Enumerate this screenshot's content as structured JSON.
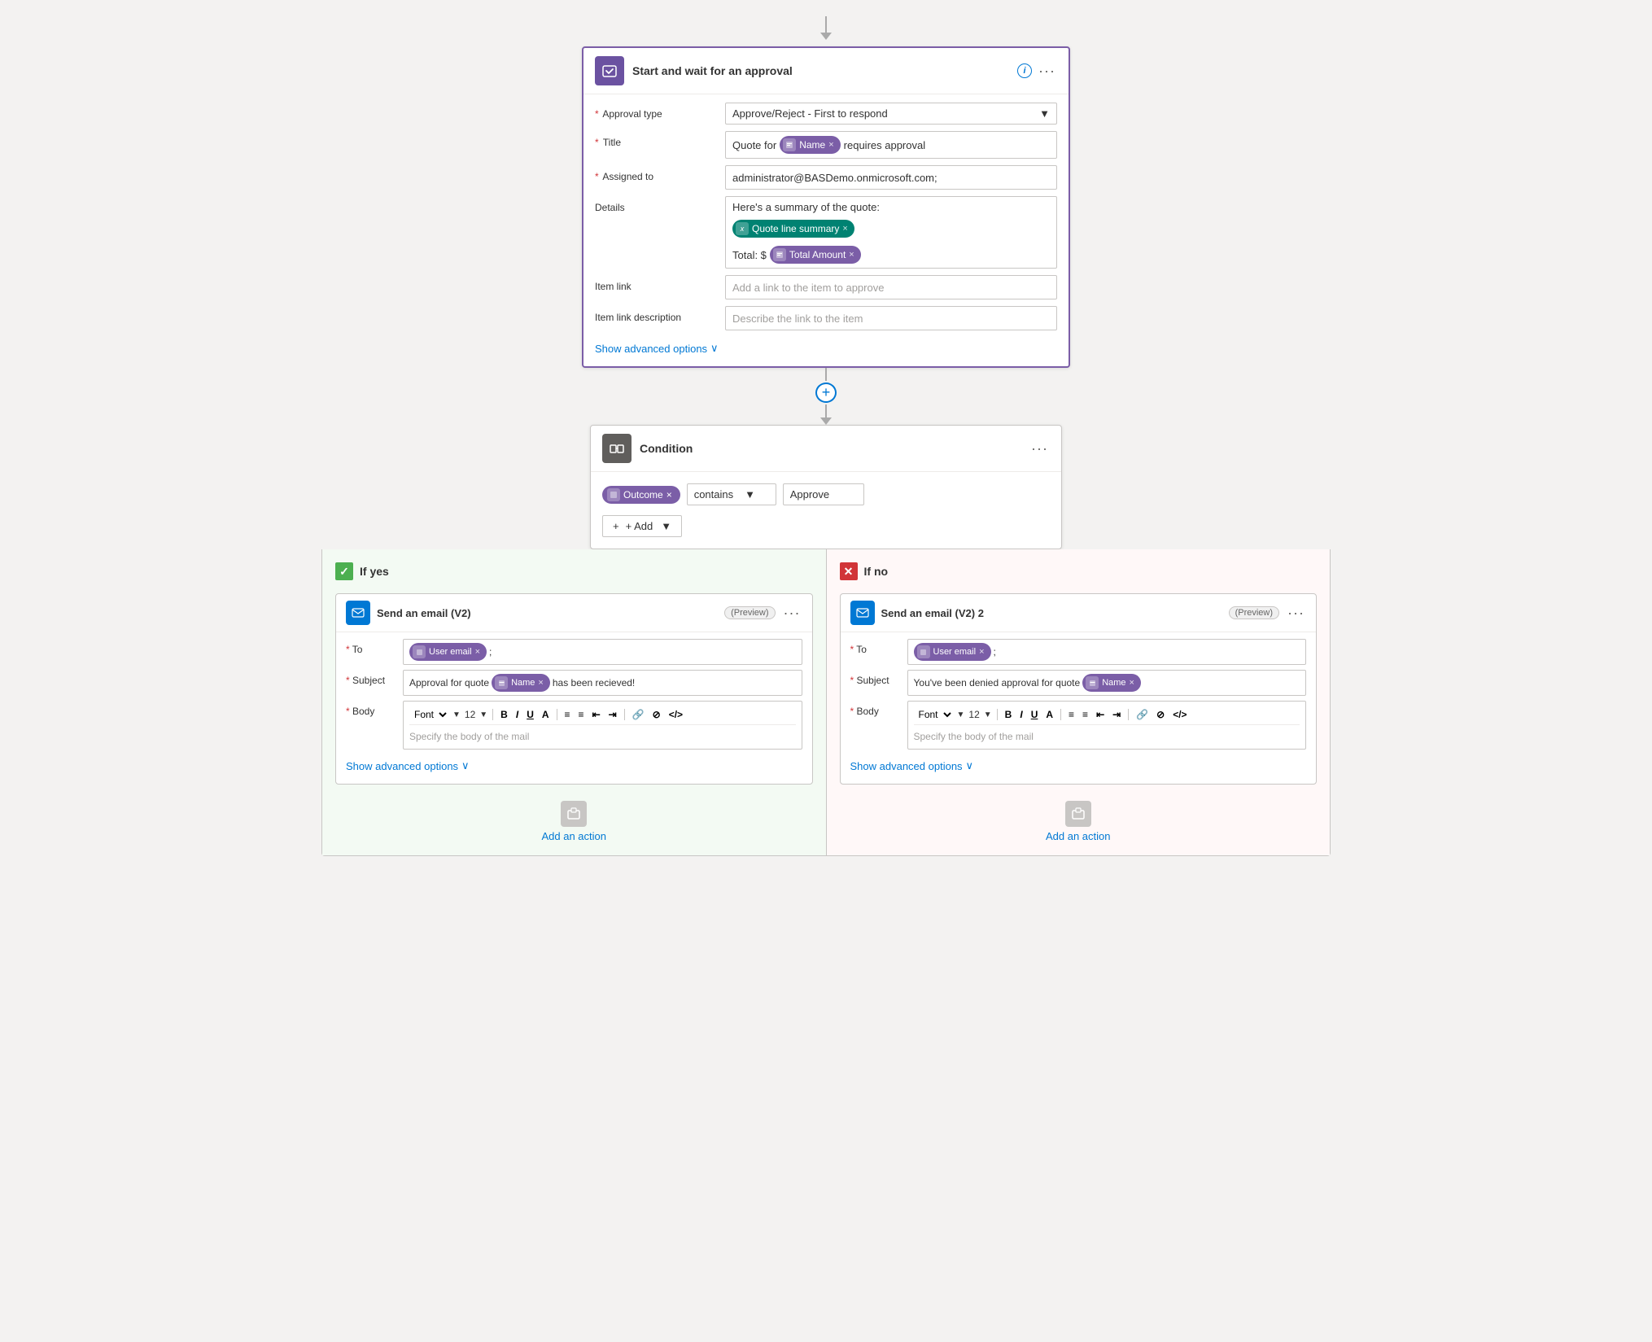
{
  "flow": {
    "topArrow": "↓",
    "approvalCard": {
      "title": "Start and wait for an approval",
      "iconLabel": "approval-icon",
      "fields": {
        "approvalType": {
          "label": "Approval type",
          "required": true,
          "value": "Approve/Reject - First to respond"
        },
        "title": {
          "label": "Title",
          "required": true,
          "prefix": "Quote for",
          "token1": {
            "label": "Name",
            "type": "purple"
          },
          "suffix": "requires approval"
        },
        "assignedTo": {
          "label": "Assigned to",
          "required": true,
          "value": "administrator@BASDemo.onmicrosoft.com;"
        },
        "details": {
          "label": "Details",
          "line1": "Here's a summary of the quote:",
          "token1": {
            "label": "Quote line summary",
            "type": "teal"
          },
          "line2": "Total: $",
          "token2": {
            "label": "Total Amount",
            "type": "purple"
          }
        },
        "itemLink": {
          "label": "Item link",
          "placeholder": "Add a link to the item to approve"
        },
        "itemLinkDescription": {
          "label": "Item link description",
          "placeholder": "Describe the link to the item"
        }
      },
      "showAdvanced": "Show advanced options"
    },
    "conditionCard": {
      "title": "Condition",
      "token": {
        "label": "Outcome",
        "type": "purple"
      },
      "operator": "contains",
      "value": "Approve",
      "addBtn": "+ Add"
    },
    "branches": {
      "yes": {
        "label": "If yes",
        "emailCard": {
          "title": "Send an email (V2)",
          "preview": "(Preview)",
          "to": {
            "token": {
              "label": "User email",
              "type": "purple"
            },
            "suffix": ";"
          },
          "subject": {
            "prefix": "Approval for quote",
            "token": {
              "label": "Name",
              "type": "purple"
            },
            "suffix": "has been recieved!"
          },
          "body": {
            "toolbar": {
              "font": "Font",
              "size": "12",
              "bold": "B",
              "italic": "I",
              "underline": "U",
              "color": "A",
              "listBullet": "≡",
              "listNumber": "≡",
              "indentLeft": "⇤",
              "indentRight": "⇥",
              "link": "🔗",
              "unlink": "⊘",
              "code": "</>"
            },
            "placeholder": "Specify the body of the mail"
          },
          "showAdvanced": "Show advanced options"
        },
        "addAction": "Add an action"
      },
      "no": {
        "label": "If no",
        "emailCard": {
          "title": "Send an email (V2) 2",
          "preview": "(Preview)",
          "to": {
            "token": {
              "label": "User email",
              "type": "purple"
            },
            "suffix": ";"
          },
          "subject": {
            "prefix": "You've been denied approval for quote",
            "token": {
              "label": "Name",
              "type": "purple"
            }
          },
          "body": {
            "toolbar": {
              "font": "Font",
              "size": "12",
              "bold": "B",
              "italic": "I",
              "underline": "U",
              "color": "A",
              "listBullet": "≡",
              "listNumber": "≡",
              "indentLeft": "⇤",
              "indentRight": "⇥",
              "link": "🔗",
              "unlink": "⊘",
              "code": "</>"
            },
            "placeholder": "Specify the body of the mail"
          },
          "showAdvanced": "Show advanced options"
        },
        "addAction": "Add an action"
      }
    }
  }
}
